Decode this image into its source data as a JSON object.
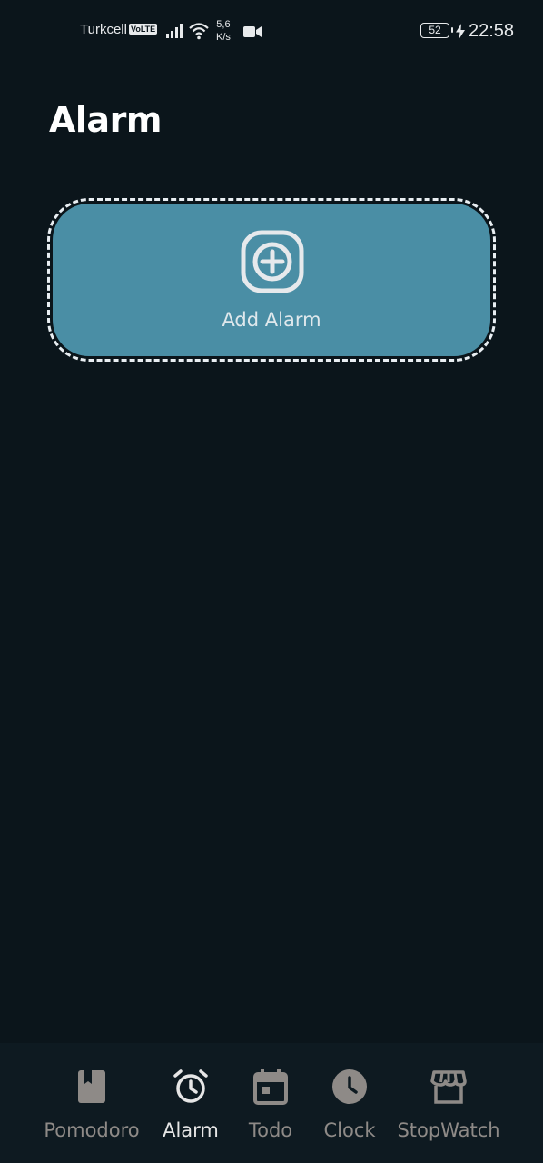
{
  "status_bar": {
    "carrier": "Turkcell",
    "volte": "VoLTE",
    "speed_value": "5,6",
    "speed_unit": "K/s",
    "battery": "52",
    "time": "22:58"
  },
  "page": {
    "title": "Alarm"
  },
  "add_alarm": {
    "label": "Add Alarm",
    "icon": "plus-square-icon",
    "background": "#4a8ea5"
  },
  "bottom_nav": {
    "active": "Alarm",
    "items": [
      {
        "label": "Pomodoro",
        "icon": "book-icon"
      },
      {
        "label": "Alarm",
        "icon": "alarm-clock-icon"
      },
      {
        "label": "Todo",
        "icon": "calendar-icon"
      },
      {
        "label": "Clock",
        "icon": "clock-icon"
      },
      {
        "label": "StopWatch",
        "icon": "store-icon"
      }
    ],
    "inactive_color": "#8e8a87",
    "active_color": "#e6e6e6"
  }
}
